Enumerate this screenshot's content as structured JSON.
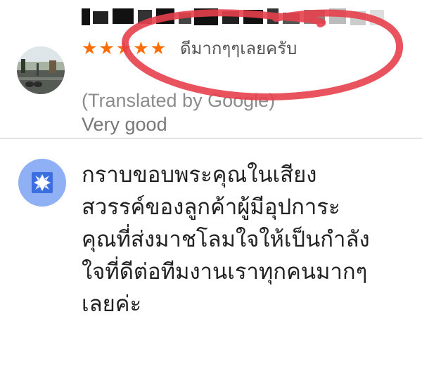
{
  "review": {
    "reviewer_name": "",
    "avatar_icon": "profile-photo",
    "rating": 5,
    "stars": [
      "★",
      "★",
      "★",
      "★",
      "★"
    ],
    "text": "ดีมากๆๆเลยครับ",
    "translated_note": "(Translated by Google)",
    "translation": "Very good",
    "annotation_color": "#e5404b"
  },
  "owner_reply": {
    "avatar_icon": "business-profile-icon",
    "avatar_color": "#8fb0f4",
    "icon_color": "#3b6fe0",
    "lines": [
      "กราบขอบพระคุณในเสียง",
      "สวรรค์ของลูกค้าผู้มีอุปการะ",
      "คุณที่ส่งมาชโลมใจให้เป็นกำลัง",
      "ใจที่ดีต่อทีมงานเราทุกคนมากๆ",
      "เลยค่ะ"
    ]
  }
}
